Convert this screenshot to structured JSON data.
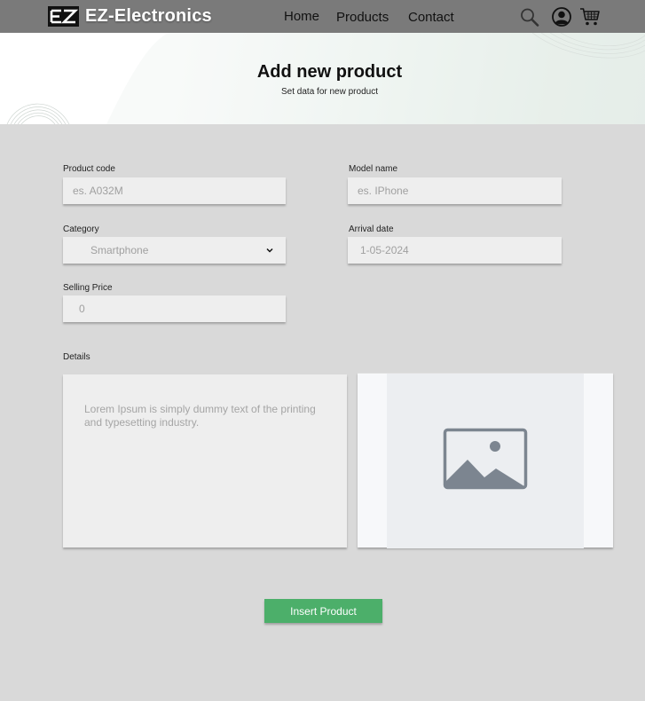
{
  "nav": {
    "brand": "EZ-Electronics",
    "home": "Home",
    "products": "Products",
    "contact": "Contact"
  },
  "hero": {
    "title": "Add new product",
    "subtitle": "Set data for new product"
  },
  "form": {
    "product_code": {
      "label": "Product code",
      "placeholder": "es. A032M"
    },
    "model_name": {
      "label": "Model name",
      "placeholder": "es. IPhone"
    },
    "category": {
      "label": "Category",
      "value": "Smartphone"
    },
    "arrival_date": {
      "label": "Arrival date",
      "value": "1-05-2024"
    },
    "selling_price": {
      "label": "Selling Price",
      "value": "0"
    },
    "details": {
      "label": "Details",
      "placeholder": "Lorem Ipsum is simply dummy text of the printing and typesetting industry."
    }
  },
  "actions": {
    "insert": "Insert Product"
  },
  "colors": {
    "navbar": "#7a7a7a",
    "background": "#d9d9d9",
    "field": "#eeeeee",
    "accent": "#4caf6a"
  }
}
